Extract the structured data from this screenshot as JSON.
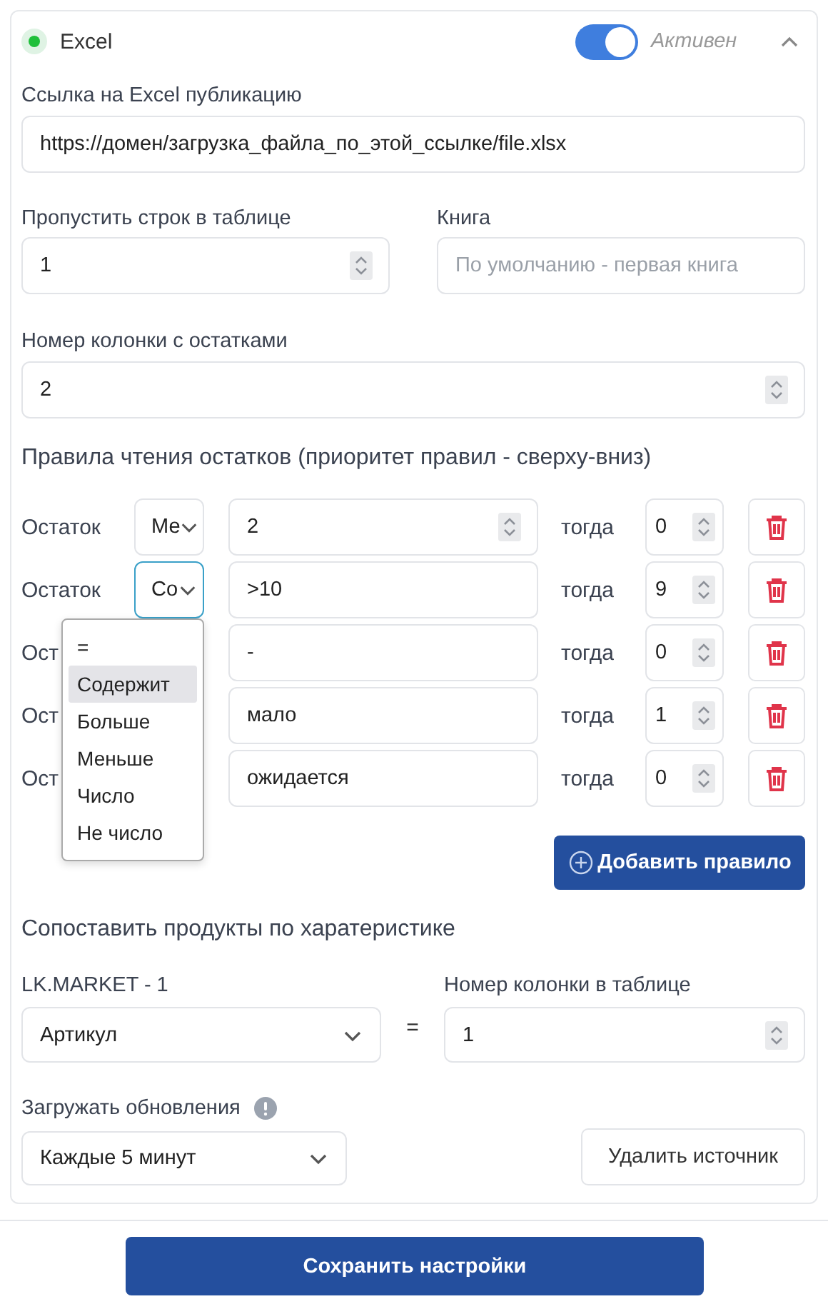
{
  "source": {
    "status_active": true,
    "title": "Excel",
    "toggle": {
      "on": true,
      "label": "Активен"
    },
    "expanded": true
  },
  "url_field": {
    "label": "Ссылка на Excel публикацию",
    "value": "https://домен/загрузка_файла_по_этой_ссылке/file.xlsx"
  },
  "skip_rows": {
    "label": "Пропустить строк в таблице",
    "value": "1"
  },
  "book": {
    "label": "Книга",
    "placeholder": "По умолчанию - первая книга"
  },
  "stock_column": {
    "label": "Номер колонки с остатками",
    "value": "2"
  },
  "rules_heading": "Правила чтения остатков (приоритет правил - сверху-вниз)",
  "rules": [
    {
      "label": "Остаток",
      "operator": "Ме",
      "focused": false,
      "kind": "number",
      "pattern": "2",
      "then_label": "тогда",
      "result": "0"
    },
    {
      "label": "Остаток",
      "operator": "Со",
      "focused": true,
      "kind": "text",
      "pattern": ">10",
      "then_label": "тогда",
      "result": "9"
    },
    {
      "label": "Ост",
      "kind": "text",
      "pattern": "-",
      "then_label": "тогда",
      "result": "0"
    },
    {
      "label": "Ост",
      "kind": "text",
      "pattern": "мало",
      "then_label": "тогда",
      "result": "1"
    },
    {
      "label": "Ост",
      "kind": "text",
      "pattern": "ожидается",
      "then_label": "тогда",
      "result": "0"
    }
  ],
  "operator_menu": {
    "options": [
      {
        "label": "=",
        "selected": false
      },
      {
        "label": "Содержит",
        "selected": true
      },
      {
        "label": "Больше",
        "selected": false
      },
      {
        "label": "Меньше",
        "selected": false
      },
      {
        "label": "Число",
        "selected": false
      },
      {
        "label": "Не число",
        "selected": false
      }
    ]
  },
  "add_rule_button": "Добавить правило",
  "match_heading": "Сопоставить продукты по харатеристике",
  "match": {
    "left_label": "LK.MARKET - 1",
    "left_value": "Артикул",
    "equals": "=",
    "right_label": "Номер колонки в таблице",
    "right_value": "1"
  },
  "updates": {
    "label": "Загружать обновления",
    "value": "Каждые 5 минут"
  },
  "delete_source_button": "Удалить источник",
  "save_button": "Сохранить настройки"
}
